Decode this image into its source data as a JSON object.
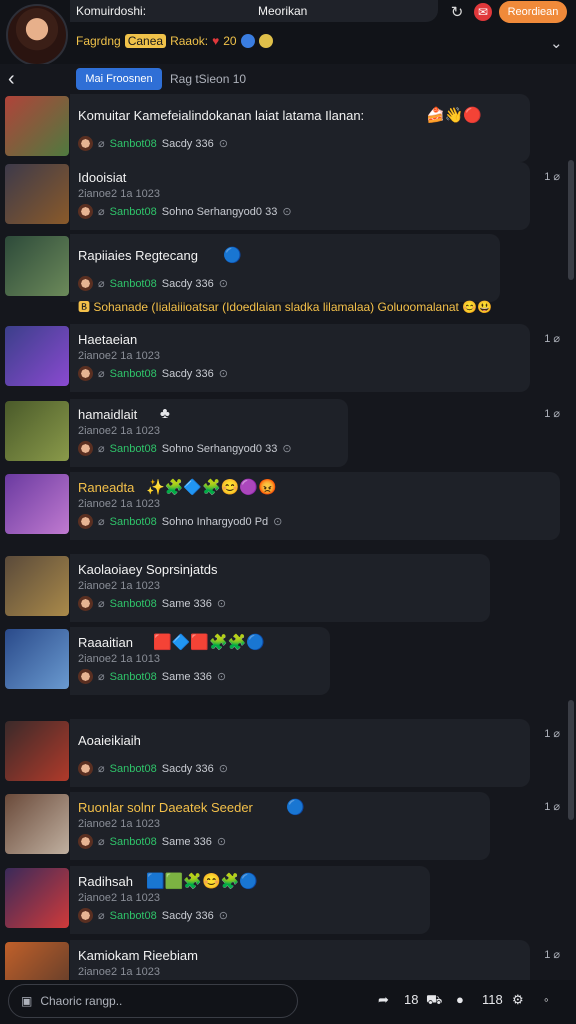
{
  "header": {
    "title_left": "Komuirdoshi:",
    "title_right": "Meorikan",
    "orange_button": "Reordiean",
    "sub": {
      "yellow1": "Fagrdng",
      "tag": "Canea",
      "yellow2": "Raaok:",
      "nums": "20"
    }
  },
  "tabs": {
    "active": "Mai Froosnen",
    "other": "Rag tSieon 10"
  },
  "rows": [
    {
      "name": "Komuitar Kamefeialindokanan laiat latama Ilanan:",
      "gold": false,
      "time": "",
      "meta_green": "Sanbot08",
      "meta_white": "Sacdy 336",
      "badge": "",
      "emojis": "🍰👋🔴",
      "thumb": [
        "#b0433a",
        "#4f7a3f"
      ]
    },
    {
      "name": "Idooisiat",
      "gold": false,
      "time": "2ianoe2 1a 1023",
      "meta_green": "Sanbot08",
      "meta_white": "Sohno Serhangyod0 33",
      "badge": "1 ⌀",
      "emojis": "",
      "thumb": [
        "#3d3a4a",
        "#8a5a2a"
      ]
    },
    {
      "name": "Rapiiaies Regtecang",
      "gold": false,
      "time": "",
      "meta_green": "Sanbot08",
      "meta_white": "Sacdy 336",
      "badge": "",
      "emojis": "🔵",
      "thumb": [
        "#2d4a3a",
        "#6c8a5a"
      ]
    },
    {
      "name": "Haetaeian",
      "gold": false,
      "time": "2ianoe2 1a 1023",
      "meta_green": "Sanbot08",
      "meta_white": "Sacdy 336",
      "badge": "1 ⌀",
      "emojis": "",
      "thumb": [
        "#3b3f8a",
        "#8a4ad0"
      ]
    },
    {
      "name": "hamaidlait",
      "gold": false,
      "time": "2ianoe2 1a 1023",
      "meta_green": "Sanbot08",
      "meta_white": "Sohno Serhangyod0 33",
      "badge": "1 ⌀",
      "emojis": "♣",
      "thumb": [
        "#4a5a2a",
        "#8a9a4a"
      ]
    },
    {
      "name": "Raneadta",
      "gold": true,
      "time": "2ianoe2 1a 1023",
      "meta_green": "Sanbot08",
      "meta_white": "Sohno Inhargyod0 Pd",
      "badge": "",
      "emojis": "✨🧩🔷🧩😊🟣😡",
      "thumb": [
        "#6a3aa0",
        "#c07ad0"
      ]
    },
    {
      "name": "Kaolaoiaey Soprsinjatds",
      "gold": false,
      "time": "2ianoe2 1a 1023",
      "meta_green": "Sanbot08",
      "meta_white": "Same 336",
      "badge": "",
      "emojis": "",
      "thumb": [
        "#5a4a3a",
        "#aa8a4a"
      ]
    },
    {
      "name": "Raaaitian",
      "gold": false,
      "time": "2ianoe2 1a 1013",
      "meta_green": "Sanbot08",
      "meta_white": "Same 336",
      "badge": "",
      "emojis": "🟥🔷🟥🧩🧩🔵",
      "thumb": [
        "#2a4a8a",
        "#6a9ad0"
      ]
    },
    {
      "name": "Aoaieikiaih",
      "gold": false,
      "time": "",
      "meta_green": "Sanbot08",
      "meta_white": "Sacdy 336",
      "badge": "1 ⌀",
      "emojis": "",
      "thumb": [
        "#3a2a2a",
        "#b03a2a"
      ]
    },
    {
      "name": "Ruonlar solnr Daeatek Seeder",
      "gold": true,
      "time": "2ianoe2 1a 1023",
      "meta_green": "Sanbot08",
      "meta_white": "Same 336",
      "badge": "1 ⌀",
      "emojis": "🔵",
      "thumb": [
        "#6a4a3a",
        "#c0b0a0"
      ]
    },
    {
      "name": "Radihsah",
      "gold": false,
      "time": "2ianoe2 1a 1023",
      "meta_green": "Sanbot08",
      "meta_white": "Sacdy 336",
      "badge": "",
      "emojis": "🟦🟩🧩😊🧩🔵",
      "thumb": [
        "#3a2a5a",
        "#d03a3a"
      ]
    },
    {
      "name": "Kamiokam Rieebiam",
      "gold": false,
      "time": "2ianoe2 1a 1023",
      "meta_green": "",
      "meta_white": "",
      "badge": "1 ⌀",
      "emojis": "",
      "thumb": [
        "#c0602a",
        "#5a3a2a"
      ]
    }
  ],
  "notice": "🅱 Sohanade (Iialaiiioatsar (Idoedlaian sladka lilamalaa) Goluoomalanat 😊😃",
  "bottom": {
    "input_placeholder": "Chaoric rangp..",
    "count1": "18",
    "count2": "118"
  }
}
